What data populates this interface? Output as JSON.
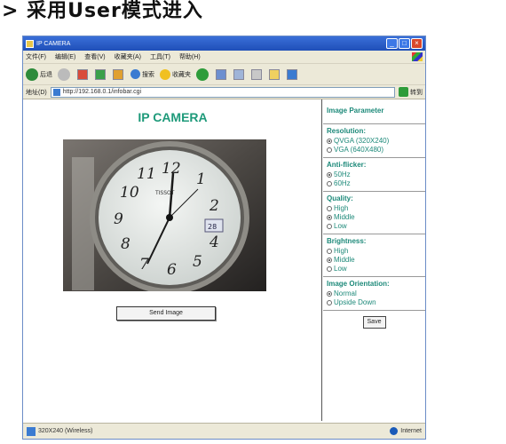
{
  "page_heading": "> 采用User模式进入",
  "window": {
    "title": "IP CAMERA"
  },
  "menubar": {
    "items": [
      "文件(F)",
      "编辑(E)",
      "查看(V)",
      "收藏夹(A)",
      "工具(T)",
      "帮助(H)"
    ]
  },
  "toolbar": {
    "back_label": "后退",
    "search_label": "搜索",
    "favorites_label": "收藏夹"
  },
  "addressbar": {
    "label": "地址(D)",
    "url": "http://192.168.0.1/infobar.cgi",
    "go_label": "转到"
  },
  "page": {
    "title": "IP CAMERA",
    "snapshot_button": "Send Image"
  },
  "settings": {
    "header": "Image Parameter",
    "resolution": {
      "label": "Resolution:",
      "options": [
        "QVGA (320X240)",
        "VGA (640X480)"
      ],
      "selected": 0
    },
    "anti_flicker": {
      "label": "Anti-flicker:",
      "options": [
        "50Hz",
        "60Hz"
      ],
      "selected": 0
    },
    "quality": {
      "label": "Quality:",
      "options": [
        "High",
        "Middle",
        "Low"
      ],
      "selected": 1
    },
    "brightness": {
      "label": "Brightness:",
      "options": [
        "High",
        "Middle",
        "Low"
      ],
      "selected": 1
    },
    "orientation": {
      "label": "Image Orientation:",
      "options": [
        "Normal",
        "Upside Down"
      ],
      "selected": 0
    },
    "save_button": "Save"
  },
  "statusbar": {
    "text": "320X240 (Wireless)",
    "zone": "Internet"
  },
  "colors": {
    "accent_teal": "#1e9a7a",
    "titlebar_blue": "#1f4fb8"
  }
}
